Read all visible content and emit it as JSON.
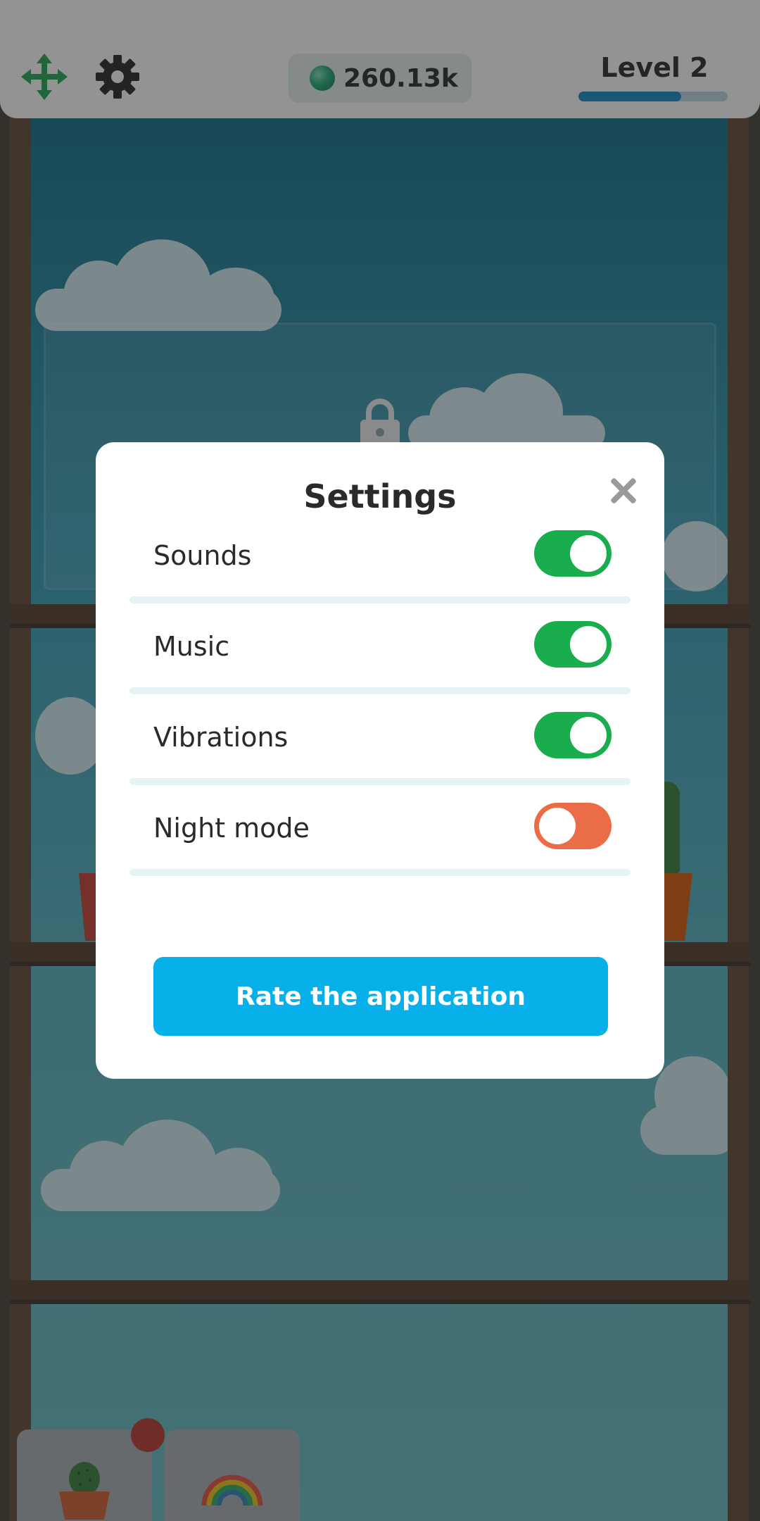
{
  "topbar": {
    "icons": {
      "move": "move-arrows-icon",
      "settings": "gear-icon",
      "currency": "coin-icon"
    },
    "currency_value": "260.13k",
    "level_label": "Level 2",
    "level_progress": 0.69
  },
  "dialog": {
    "title": "Settings",
    "close_icon": "close-icon",
    "settings": [
      {
        "label": "Sounds",
        "enabled": true
      },
      {
        "label": "Music",
        "enabled": true
      },
      {
        "label": "Vibrations",
        "enabled": true
      },
      {
        "label": "Night mode",
        "enabled": false
      }
    ],
    "rate_button_label": "Rate the application"
  },
  "dock": {
    "tabs": [
      {
        "icon": "cactus-pot-icon",
        "has_badge": true
      },
      {
        "icon": "rainbow-icon",
        "has_badge": false
      }
    ]
  },
  "colors": {
    "toggle_on": "#1aad4e",
    "toggle_off": "#ea6d47",
    "primary_button": "#08b0ea",
    "level_bar": "#0b86c3"
  }
}
